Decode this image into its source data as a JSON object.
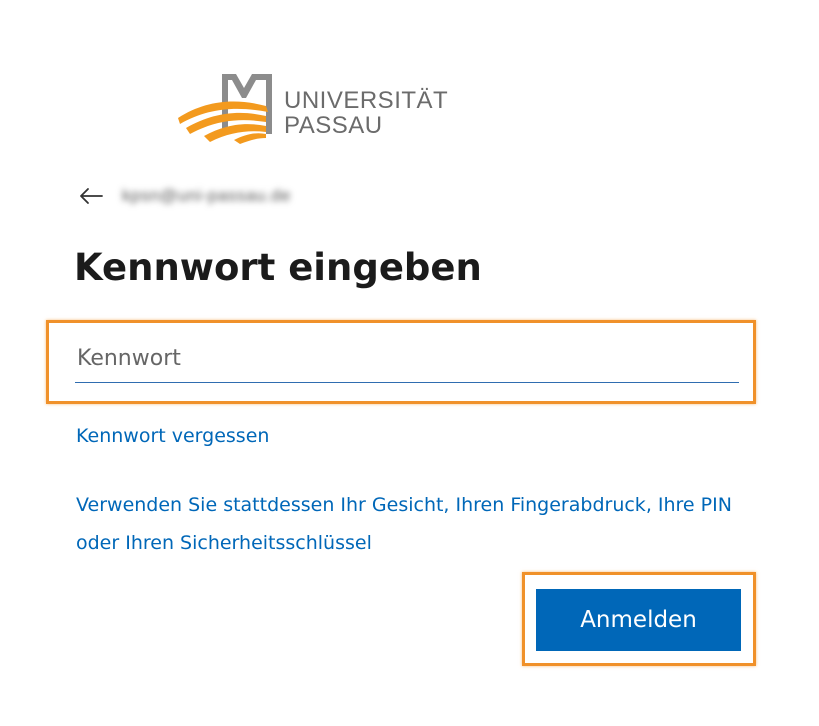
{
  "logo": {
    "line1": "UNIVERSITÄT",
    "line2": "PASSAU",
    "icon": "passau-logo-icon"
  },
  "identity": {
    "back_icon": "back-arrow-icon",
    "account": "kpsn@uni-passau.de"
  },
  "title": "Kennwort eingeben",
  "password": {
    "placeholder": "Kennwort",
    "value": ""
  },
  "links": {
    "forgot": "Kennwort vergessen",
    "alternative": "Verwenden Sie stattdessen Ihr Gesicht, Ihren Fingerabdruck, Ihre PIN oder Ihren Sicherheitsschlüssel"
  },
  "button": {
    "signin": "Anmelden"
  },
  "colors": {
    "accent": "#0067b8",
    "highlight": "#f0912a",
    "logo_orange": "#f39a1e",
    "logo_gray": "#6b6b6b"
  }
}
